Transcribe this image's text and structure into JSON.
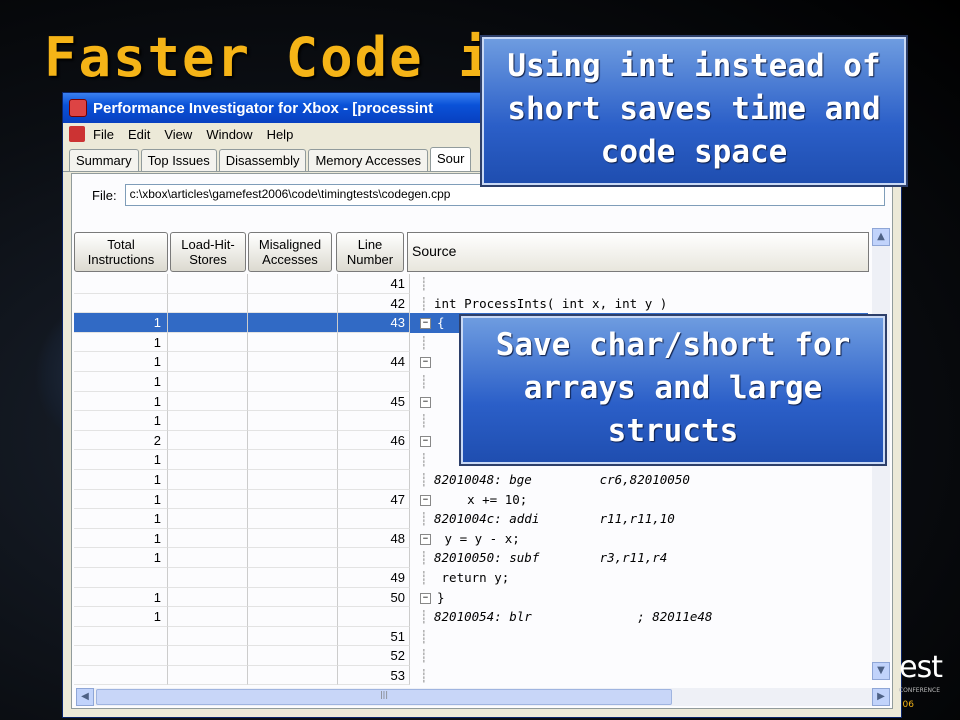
{
  "slide": {
    "title": "Faster Code in",
    "logo_text": "est",
    "logo_subtext": "CONFERENCE",
    "logo_year": "06"
  },
  "window": {
    "title": "Performance Investigator for Xbox - [processint",
    "menu": [
      "File",
      "Edit",
      "View",
      "Window",
      "Help"
    ],
    "tabs": [
      "Summary",
      "Top Issues",
      "Disassembly",
      "Memory Accesses",
      "Sour"
    ],
    "active_tab": "Sour",
    "file_label": "File:",
    "file_path": "c:\\xbox\\articles\\gamefest2006\\code\\timingtests\\codegen.cpp",
    "columns": {
      "total_instructions": "Total Instructions",
      "load_hit_stores": "Load-Hit- Stores",
      "misaligned_accesses": "Misaligned Accesses",
      "line_number": "Line Number",
      "source": "Source"
    },
    "rows": [
      {
        "total": "",
        "line": "41",
        "source": "",
        "kind": "code",
        "marker": "tree"
      },
      {
        "total": "",
        "line": "42",
        "source": "int ProcessInts( int x, int y )",
        "kind": "code",
        "marker": "tree"
      },
      {
        "total": "1",
        "line": "43",
        "source": "{",
        "kind": "code",
        "marker": "minus",
        "selected": true
      },
      {
        "total": "1",
        "line": "",
        "source": "",
        "kind": "asm",
        "marker": "tree"
      },
      {
        "total": "1",
        "line": "44",
        "source": "",
        "kind": "code",
        "marker": "minus"
      },
      {
        "total": "1",
        "line": "",
        "source": "",
        "kind": "asm",
        "marker": "tree"
      },
      {
        "total": "1",
        "line": "45",
        "source": "",
        "kind": "code",
        "marker": "minus"
      },
      {
        "total": "1",
        "line": "",
        "source": "",
        "kind": "asm",
        "marker": "tree"
      },
      {
        "total": "2",
        "line": "46",
        "source": "",
        "kind": "code",
        "marker": "minus"
      },
      {
        "total": "1",
        "line": "",
        "source": "",
        "kind": "asm",
        "marker": "tree"
      },
      {
        "total": "1",
        "line": "",
        "source": "82010048: bge         cr6,82010050",
        "kind": "asm",
        "marker": "tree"
      },
      {
        "total": "1",
        "line": "47",
        "source": "    x += 10;",
        "kind": "code",
        "marker": "minus"
      },
      {
        "total": "1",
        "line": "",
        "source": "8201004c: addi        r11,r11,10",
        "kind": "asm",
        "marker": "tree"
      },
      {
        "total": "1",
        "line": "48",
        "source": " y = y - x;",
        "kind": "code",
        "marker": "minus"
      },
      {
        "total": "1",
        "line": "",
        "source": "82010050: subf        r3,r11,r4",
        "kind": "asm",
        "marker": "tree"
      },
      {
        "total": "",
        "line": "49",
        "source": " return y;",
        "kind": "code",
        "marker": "tree"
      },
      {
        "total": "1",
        "line": "50",
        "source": "}",
        "kind": "code",
        "marker": "minus"
      },
      {
        "total": "1",
        "line": "",
        "source": "82010054: blr              ; 82011e48",
        "kind": "asm",
        "marker": "tree"
      },
      {
        "total": "",
        "line": "51",
        "source": "",
        "kind": "code",
        "marker": "tree"
      },
      {
        "total": "",
        "line": "52",
        "source": "",
        "kind": "code",
        "marker": "tree"
      },
      {
        "total": "",
        "line": "53",
        "source": "",
        "kind": "code",
        "marker": "tree"
      }
    ]
  },
  "callouts": {
    "int_vs_short": "Using int instead of short saves time and code space",
    "char_short": "Save char/short for arrays and large structs"
  },
  "colors": {
    "title": "#f5b417",
    "selection": "#316ac5",
    "callout": "#2b5fc8"
  }
}
